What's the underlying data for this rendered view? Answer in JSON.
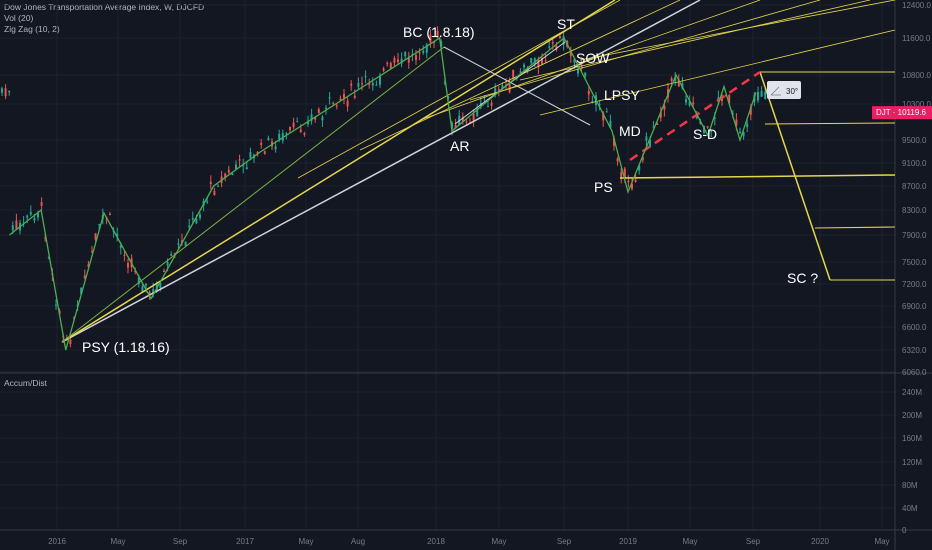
{
  "header": {
    "title": "Dow Jones Transportation Average Index, W, DJCFD",
    "indicator_vol": "Vol (20)",
    "indicator_zigzag": "Zig Zag (10, 2)",
    "lower_pane_title": "Accum/Dist"
  },
  "price_badge": {
    "symbol": "DJT",
    "value": "10119.6",
    "color": "#e91e63"
  },
  "angle_label": "30°",
  "colors": {
    "background": "#131722",
    "grid": "#1e222d",
    "candle_up": "#26a69a",
    "candle_down": "#ef5350",
    "zigzag": "#4caf50",
    "pitchfork": "#e6d74a",
    "trendline_white": "#d1d4dc",
    "dashed": "#f23645",
    "text": "#ffffff",
    "axis_text": "#787b86"
  },
  "annotations": [
    {
      "id": "psy",
      "text": "PSY (1.18.16)"
    },
    {
      "id": "bc",
      "text": "BC (1.8.18)"
    },
    {
      "id": "ar",
      "text": "AR"
    },
    {
      "id": "st",
      "text": "ST"
    },
    {
      "id": "sow",
      "text": "SOW"
    },
    {
      "id": "lpsy",
      "text": "LPSY"
    },
    {
      "id": "md",
      "text": "MD"
    },
    {
      "id": "ps",
      "text": "PS"
    },
    {
      "id": "sd",
      "text": "S-D"
    },
    {
      "id": "sc",
      "text": "SC ?"
    }
  ],
  "chart_data": {
    "type": "line",
    "price_axis_ticks": [
      "12400.0",
      "11600.0",
      "10800.0",
      "10300.0",
      "9500.0",
      "9100.0",
      "8700.0",
      "8300.0",
      "7900.0",
      "7500.0",
      "7200.0",
      "6900.0",
      "6600.0",
      "6320.0",
      "6060.0"
    ],
    "volume_axis_ticks": [
      "240M",
      "200M",
      "160M",
      "120M",
      "80M",
      "40M",
      "0"
    ],
    "time_axis_ticks": [
      "2016",
      "May",
      "Sep",
      "2017",
      "May",
      "Aug",
      "2018",
      "May",
      "Sep",
      "2019",
      "May",
      "Sep",
      "2020",
      "May"
    ],
    "last_price": 10119.6,
    "zigzag_series": {
      "name": "Zig Zag (10, 2)",
      "x": [
        "2015-10",
        "2015-12",
        "2016-01-18",
        "2016-04",
        "2016-07",
        "2016-11",
        "2017-02",
        "2018-01-08",
        "2018-02",
        "2018-04",
        "2018-09",
        "2018-12",
        "2019-01",
        "2019-04",
        "2019-06",
        "2019-07",
        "2019-08",
        "2019-09"
      ],
      "y": [
        7900,
        8300,
        6320,
        8250,
        7000,
        8700,
        9300,
        11600,
        9700,
        10300,
        11600,
        9700,
        8600,
        10800,
        9600,
        10600,
        9500,
        10500
      ]
    }
  }
}
